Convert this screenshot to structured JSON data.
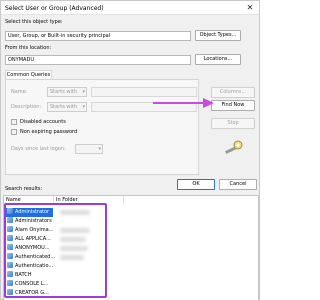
{
  "window": {
    "title": "Select User or Group (Advanced)",
    "close_glyph": "✕"
  },
  "object_type": {
    "label": "Select this object type:",
    "value": "User, Group, or Built-in security principal",
    "button": "Object Types..."
  },
  "location": {
    "label": "From this location:",
    "value": "ONYMADU",
    "button": "Locations..."
  },
  "common_queries": {
    "tab": "Common Queries",
    "name_label": "Name:",
    "name_mode": "Starts with",
    "description_label": "Description:",
    "description_mode": "Starts with",
    "disabled_accounts": "Disabled accounts",
    "non_expiring": "Non expiring password",
    "days_label": "Days since last logon:"
  },
  "side_buttons": {
    "columns": "Columns...",
    "find_now": "Find Now",
    "stop": "Stop"
  },
  "dialog_buttons": {
    "ok": "OK",
    "cancel": "Cancel"
  },
  "results": {
    "label": "Search results:",
    "headers": [
      "Name",
      "In Folder"
    ],
    "rows": [
      "Administrator",
      "Administrators",
      "Alam Onyima...",
      "ALL APPLICA...",
      "ANONYMOU...",
      "Authenticated...",
      "Authenticatio...",
      "BATCH",
      "CONSOLE L...",
      "CREATOR G..."
    ]
  }
}
